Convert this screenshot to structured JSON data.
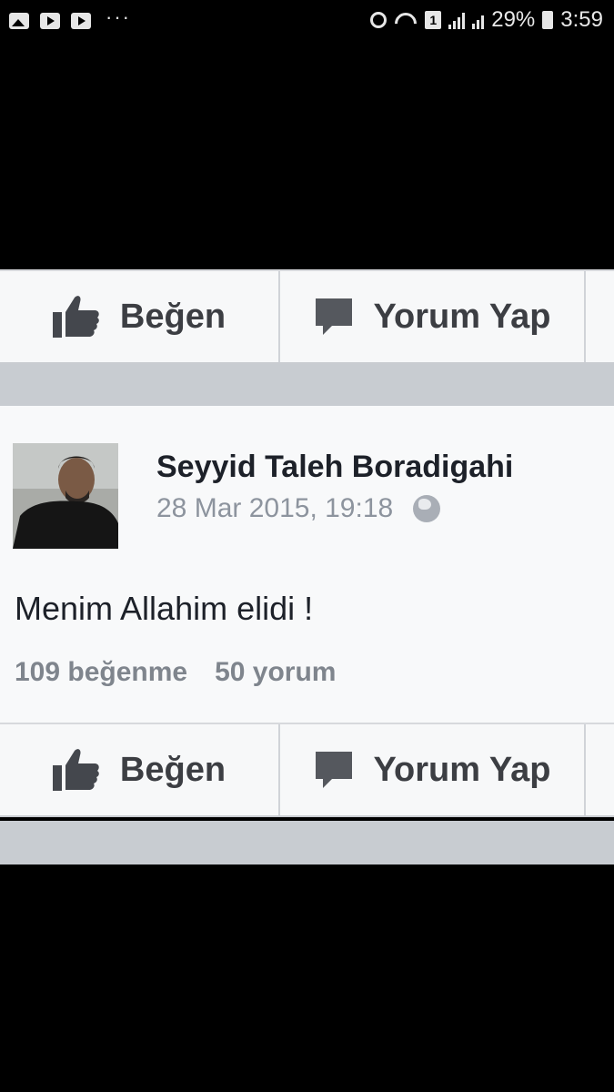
{
  "status_bar": {
    "battery": "29%",
    "time": "3:59",
    "sim": "1",
    "dots": "···"
  },
  "top_actions": {
    "like_label": "Beğen",
    "comment_label": "Yorum Yap"
  },
  "post": {
    "author": "Seyyid Taleh Boradigahi",
    "timestamp": "28 Mar 2015, 19:18",
    "privacy_icon": "globe-icon",
    "text": "Menim Allahim elidi !",
    "likes": "109 beğenme",
    "comments": "50 yorum"
  },
  "bottom_actions": {
    "like_label": "Beğen",
    "comment_label": "Yorum Yap"
  },
  "colors": {
    "action_text": "#3c3e43",
    "meta_text": "#8d949e",
    "divider_strip": "#c8ccd1"
  }
}
